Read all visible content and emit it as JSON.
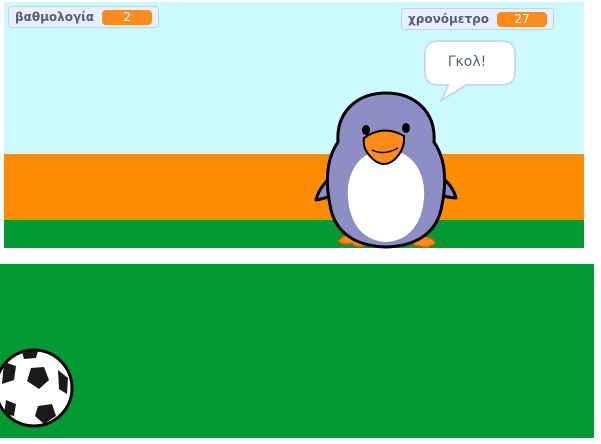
{
  "monitors": {
    "score": {
      "label": "βαθμολογία",
      "value": "2"
    },
    "timer": {
      "label": "χρονόμετρο",
      "value": "27"
    }
  },
  "speech_bubble": {
    "text": "Γκολ!"
  },
  "colors": {
    "sky": "#ccfaff",
    "orange_stripe": "#ff8c00",
    "grass": "#009933",
    "monitor_value": "#ff8c1a",
    "penguin_body": "#8e8ec7",
    "penguin_beak_feet": "#ff8c1a"
  },
  "sprites": [
    "penguin-sprite",
    "soccer-ball-sprite"
  ]
}
